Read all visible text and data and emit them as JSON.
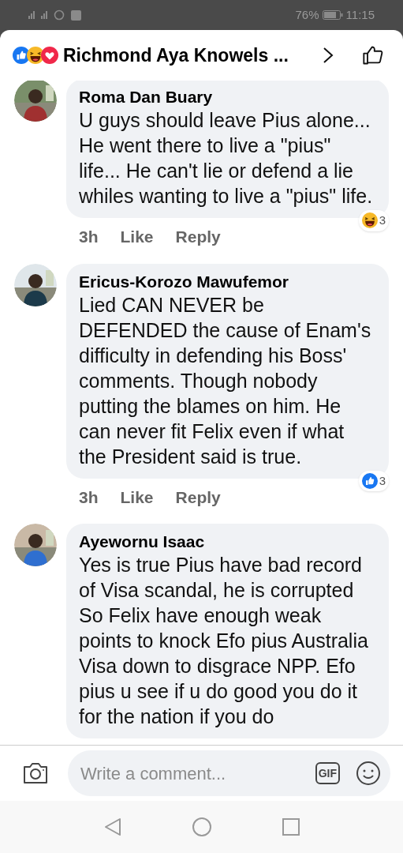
{
  "status_bar": {
    "battery": "76%",
    "time": "11:15"
  },
  "header": {
    "reactions": [
      {
        "kind": "like"
      },
      {
        "kind": "haha"
      },
      {
        "kind": "love"
      }
    ],
    "title": "Richmond Aya Knowels ..."
  },
  "comments": [
    {
      "author": "Roma Dan Buary",
      "text": "U guys should leave Pius alone... He went there to live a \"pius\" life... He can't lie or defend a lie whiles wanting to live a \"pius\" life.",
      "time": "3h",
      "like": "Like",
      "reply": "Reply",
      "reaction": {
        "kind": "haha",
        "count": "3"
      }
    },
    {
      "author": "Ericus-Korozo Mawufemor",
      "text": "Lied CAN NEVER be DEFENDED the cause of Enam's difficulty in defending his Boss' comments. Though nobody putting the blames on him. He can never fit Felix even if what the President said is true.",
      "time": "3h",
      "like": "Like",
      "reply": "Reply",
      "reaction": {
        "kind": "like",
        "count": "3"
      }
    },
    {
      "author": "Ayewornu Isaac",
      "text": "Yes is true Pius have bad record of Visa scandal, he is corrupted So Felix have enough weak points to knock Efo  pius Australia Visa  down to disgrace NPP. Efo pius u see if u do good you do it  for the nation if you do"
    }
  ],
  "composer": {
    "placeholder": "Write a comment...",
    "gif": "GIF"
  }
}
